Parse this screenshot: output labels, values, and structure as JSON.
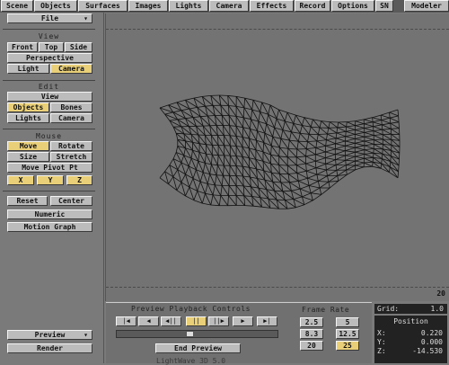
{
  "tabs": [
    "Scene",
    "Objects",
    "Surfaces",
    "Images",
    "Lights",
    "Camera",
    "Effects",
    "Record",
    "Options",
    "SN",
    "Modeler"
  ],
  "file_select": "File",
  "view": {
    "title": "View",
    "buttons": [
      "Front",
      "Top",
      "Side",
      "Perspective",
      "Light",
      "Camera"
    ],
    "active": "Camera"
  },
  "edit": {
    "title": "Edit",
    "buttons": [
      "View",
      "Objects",
      "Bones",
      "Lights",
      "Camera"
    ],
    "active": "Objects"
  },
  "mouse": {
    "title": "Mouse",
    "buttons": [
      "Move",
      "Rotate",
      "Size",
      "Stretch",
      "Move Pivot Pt"
    ],
    "active": "Move",
    "axes": [
      "X",
      "Y",
      "Z"
    ]
  },
  "actions": {
    "reset": "Reset",
    "center": "Center",
    "numeric": "Numeric",
    "motion_graph": "Motion Graph"
  },
  "bottom_left": {
    "preview": "Preview",
    "render": "Render"
  },
  "frame_readout": "20",
  "preview_controls": {
    "title": "Preview Playback Controls",
    "buttons": [
      "|◀",
      "◀",
      "◀||",
      "||",
      "||▶",
      "▶",
      "▶|"
    ],
    "active_index": 3,
    "end_preview": "End Preview",
    "slider_position": 0.45
  },
  "frame_rate": {
    "title": "Frame Rate",
    "values": [
      "2.5",
      "5",
      "8.3",
      "12.5",
      "20",
      "25"
    ],
    "active": "25"
  },
  "grid": {
    "label": "Grid:",
    "value": "1.0"
  },
  "position": {
    "title": "Position",
    "x_label": "X:",
    "x": "0.220",
    "y_label": "Y:",
    "y": "0.000",
    "z_label": "Z:",
    "z": "-14.530"
  },
  "footer_text": "LightWave 3D 5.0",
  "colors": {
    "accent": "#e8cf78",
    "button": "#bcbcbc",
    "background": "#7a7a7a"
  }
}
